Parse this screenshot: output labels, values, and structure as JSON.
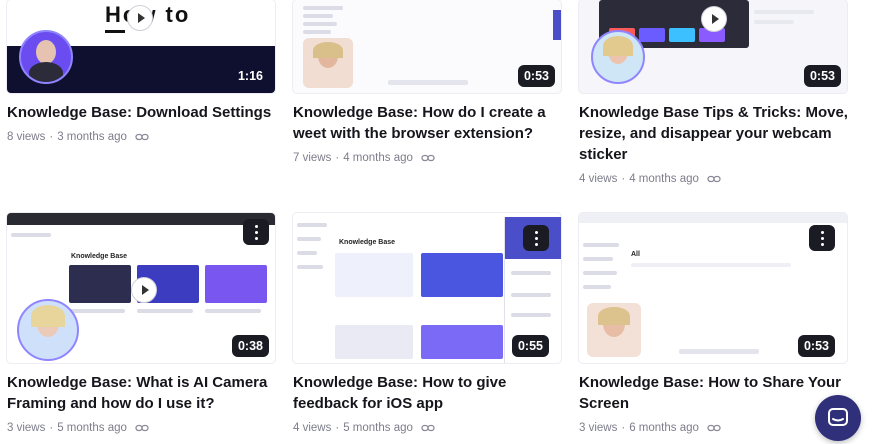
{
  "cards": [
    {
      "title": "Knowledge Base: Download Settings",
      "views": "8 views",
      "age": "3 months ago",
      "duration": "1:16",
      "thumb_title": "How to"
    },
    {
      "title": "Knowledge Base: How do I create a weet with the browser extension?",
      "views": "7 views",
      "age": "4 months ago",
      "duration": "0:53"
    },
    {
      "title": "Knowledge Base Tips & Tricks: Move, resize, and disappear your webcam sticker",
      "views": "4 views",
      "age": "4 months ago",
      "duration": "0:53"
    },
    {
      "title": "Knowledge Base: What is AI Camera Framing and how do I use it?",
      "views": "3 views",
      "age": "5 months ago",
      "duration": "0:38",
      "thumb_heading": "Knowledge Base"
    },
    {
      "title": "Knowledge Base: How to give feedback for iOS app",
      "views": "4 views",
      "age": "5 months ago",
      "duration": "0:55",
      "thumb_heading": "Knowledge Base"
    },
    {
      "title": "Knowledge Base: How to Share Your Screen",
      "views": "3 views",
      "age": "6 months ago",
      "duration": "0:53",
      "thumb_heading": "All"
    }
  ],
  "separator": "·",
  "icons": {
    "link": "link-icon",
    "more": "kebab-menu-icon",
    "play": "play-icon",
    "chat": "chat-icon"
  },
  "colors": {
    "accent": "#6b5cff",
    "chip": "#1b1b24",
    "launcher": "#2f2f7a"
  }
}
